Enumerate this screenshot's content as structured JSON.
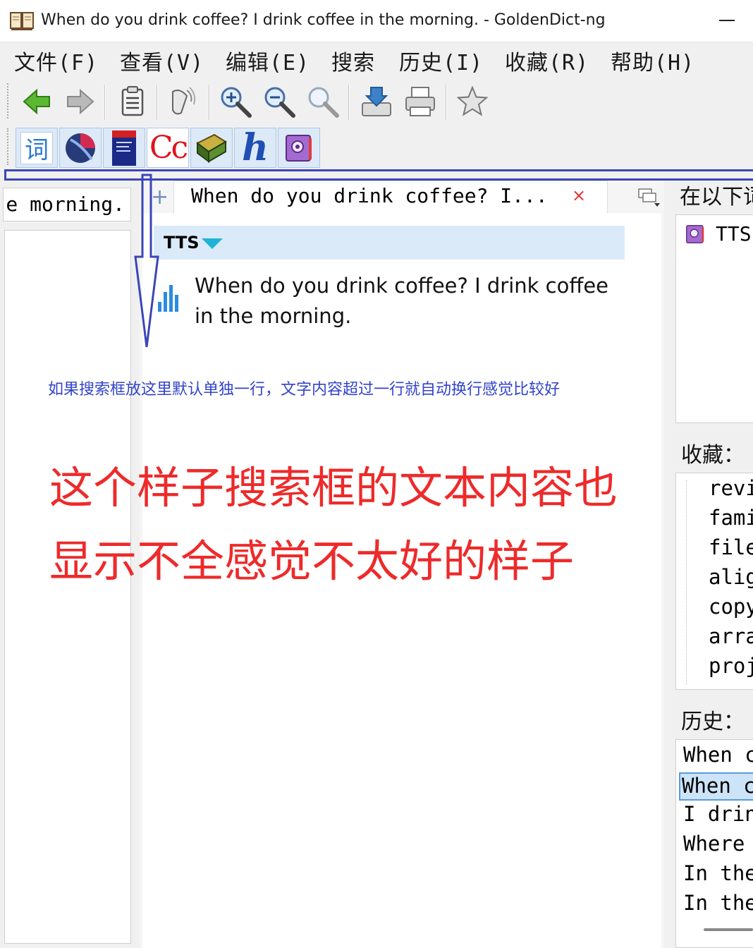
{
  "window": {
    "title": "When do you drink coffee? I drink coffee in the morning. - GoldenDict-ng"
  },
  "menu": [
    "文件(F)",
    "查看(V)",
    "编辑(E)",
    "搜索",
    "历史(I)",
    "收藏(R)",
    "帮助(H)"
  ],
  "toolbar": {
    "icons": [
      "back-arrow-icon",
      "forward-arrow-icon",
      "scan-clipboard-icon",
      "pronounce-icon",
      "zoom-in-icon",
      "zoom-out-icon",
      "zoom-reset-icon",
      "save-icon",
      "print-icon",
      "add-favorite-icon"
    ]
  },
  "dictionary_bar": {
    "buttons": [
      {
        "icon": "ci-dictionary-icon",
        "label": "词"
      },
      {
        "icon": "globe-dictionary-icon",
        "label": ""
      },
      {
        "icon": "book-cover-dictionary-icon",
        "label": ""
      },
      {
        "icon": "collins-dictionary-icon",
        "label": "Cc"
      },
      {
        "icon": "green-book-dictionary-icon",
        "label": ""
      },
      {
        "icon": "h-dictionary-icon",
        "label": "h"
      },
      {
        "icon": "tts-settings-icon",
        "label": ""
      }
    ]
  },
  "search": {
    "value": "When do you drink coffee? I drink coffee in the morning.",
    "visible_fragment": "e morning."
  },
  "tab": {
    "label": "When do you drink coffee? I...",
    "close": "×",
    "add": "+"
  },
  "article": {
    "dictionary_name": "TTS",
    "text": "When do you drink coffee? I drink coffee in the morning."
  },
  "annotations": {
    "blue_note": "如果搜索框放这里默认单独一行，文字内容超过一行就自动换行感觉比较好",
    "red_note": "这个样子搜索框的文本内容也显示不全感觉不太好的样子"
  },
  "right_panel": {
    "found_label": "在以下词",
    "found_items": [
      "TTS"
    ],
    "favorites_label": "收藏：",
    "favorites": [
      "revi",
      "fami",
      "file",
      "alig",
      "copy",
      "arra",
      "proj"
    ],
    "history_label": "历史：",
    "history": [
      "When c",
      "When c",
      "I drin",
      "Where",
      "In the",
      "In the"
    ],
    "history_selected_index": 1
  }
}
